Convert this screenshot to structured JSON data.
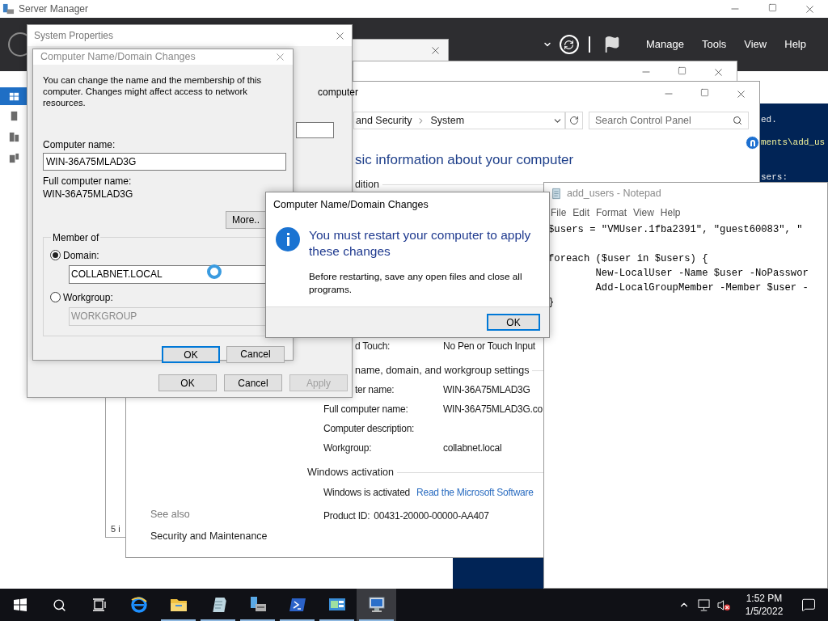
{
  "server_manager": {
    "title": "Server Manager",
    "menu": [
      "Manage",
      "Tools",
      "View",
      "Help"
    ],
    "sidebar": [
      {
        "selected": true
      },
      {
        "selected": false
      },
      {
        "selected": false
      },
      {
        "selected": false
      }
    ],
    "tile_text": "5 i"
  },
  "powershell": {
    "lines": [
      {
        "text": "ed.",
        "kind": "output"
      },
      {
        "text": "ments\\add_us",
        "kind": "command"
      },
      {
        "text": "sers:",
        "kind": "output"
      }
    ]
  },
  "control_panel": {
    "breadcrumb": [
      "and Security",
      "System"
    ],
    "search": {
      "placeholder": "Search Control Panel"
    },
    "heading": "sic information about your computer",
    "sections": [
      {
        "title": "dition",
        "kind": "partial",
        "rows": [
          {
            "label": "d Touch:",
            "value": "No Pen or Touch Input",
            "kind": "partial"
          }
        ]
      },
      {
        "title": "name, domain, and workgroup settings",
        "kind": "partial",
        "rows": [
          {
            "label": "ter name:",
            "value": "WIN-36A75MLAD3G",
            "kind": "partial"
          },
          {
            "label": "Full computer name:",
            "value": "WIN-36A75MLAD3G.co",
            "kind": "pair"
          },
          {
            "label": "Computer description:",
            "kind": "pair"
          },
          {
            "label": "Workgroup:",
            "value": "collabnet.local",
            "kind": "pair"
          }
        ]
      },
      {
        "title": "Windows activation",
        "kind": "full",
        "rows": [
          {
            "label": "Windows is activated",
            "value": "Read the Microsoft Software",
            "kind": "link"
          },
          {
            "label": "Product ID:",
            "value": "00431-20000-00000-AA407",
            "kind": "inline"
          }
        ]
      }
    ],
    "see_also": {
      "title": "See also",
      "links": [
        "Security and Maintenance"
      ]
    }
  },
  "notepad": {
    "title": "add_users - Notepad",
    "menu": [
      "File",
      "Edit",
      "Format",
      "View",
      "Help"
    ],
    "text": "$users = \"VMUser.1fba2391\", \"guest60083\", \"\n\nforeach ($user in $users) {\n\tNew-LocalUser -Name $user -NoPasswor\n\tAdd-LocalGroupMember -Member $user -\n}"
  },
  "system_properties": {
    "title": "System Properties",
    "text": "computer",
    "buttons": [
      {
        "label": "OK",
        "disabled": false
      },
      {
        "label": "Cancel",
        "disabled": false
      },
      {
        "label": "Apply",
        "disabled": true
      }
    ]
  },
  "domain_dialog": {
    "title": "Computer Name/Domain Changes",
    "description": "You can change the name and the membership of this computer. Changes might affect access to network resources.",
    "computer_name": {
      "label": "Computer name:",
      "value": "WIN-36A75MLAD3G"
    },
    "full_name": {
      "label": "Full computer name:",
      "value": "WIN-36A75MLAD3G"
    },
    "more_button": "More..",
    "member_of": {
      "title": "Member of",
      "options": [
        {
          "label": "Domain:",
          "value": "COLLABNET.LOCAL",
          "selected": true
        },
        {
          "label": "Workgroup:",
          "value": "WORKGROUP",
          "selected": false
        }
      ]
    },
    "buttons": [
      {
        "label": "OK",
        "default": true
      },
      {
        "label": "Cancel",
        "default": false
      }
    ]
  },
  "message_box": {
    "title": "Computer Name/Domain Changes",
    "heading": "You must restart your computer to apply these changes",
    "body": "Before restarting, save any open files and close all programs.",
    "button": "OK"
  },
  "taskbar": {
    "apps": [
      {
        "kind": "browser",
        "running": false,
        "selected": false
      },
      {
        "kind": "folder",
        "running": true,
        "selected": false
      },
      {
        "kind": "notepad",
        "running": true,
        "selected": false
      },
      {
        "kind": "server-manager",
        "running": true,
        "selected": false
      },
      {
        "kind": "terminal",
        "running": true,
        "selected": false
      },
      {
        "kind": "control-panel",
        "running": true,
        "selected": false
      },
      {
        "kind": "system",
        "running": true,
        "selected": true
      }
    ],
    "volume_muted": true,
    "time": "1:52 PM",
    "date": "1/5/2022"
  }
}
